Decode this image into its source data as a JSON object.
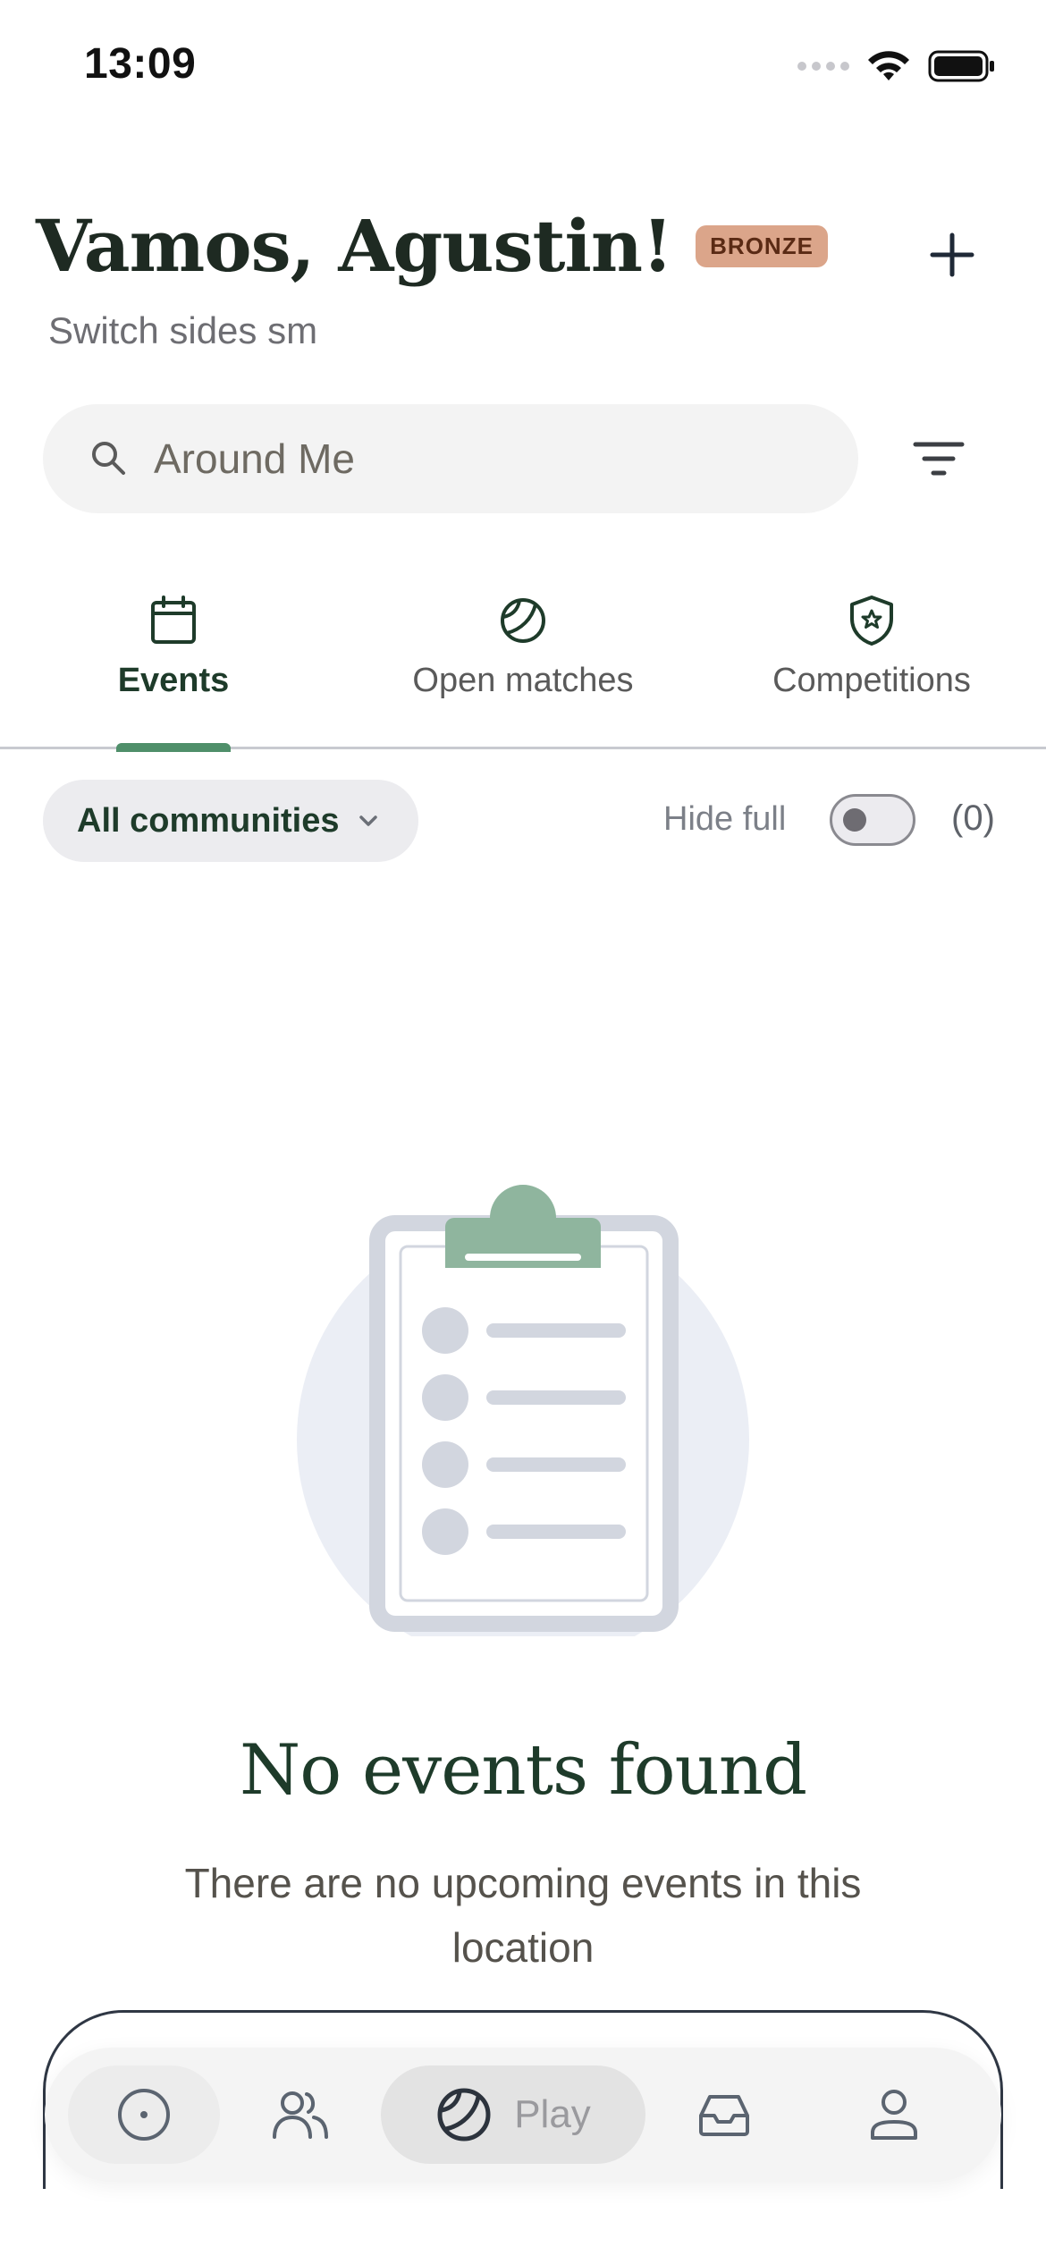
{
  "status_bar": {
    "time": "13:09"
  },
  "header": {
    "greeting": "Vamos, Agustin!",
    "rank_badge": "BRONZE",
    "subtitle": "Switch sides sm"
  },
  "search": {
    "placeholder": "Around Me"
  },
  "tabs": [
    {
      "label": "Events",
      "icon": "calendar-icon",
      "active": true
    },
    {
      "label": "Open matches",
      "icon": "tennis-ball-icon",
      "active": false
    },
    {
      "label": "Competitions",
      "icon": "shield-star-icon",
      "active": false
    }
  ],
  "filters": {
    "community_label": "All communities",
    "hide_full_label": "Hide full",
    "hide_full_on": false,
    "full_count": "(0)"
  },
  "empty_state": {
    "title": "No events found",
    "message": "There are no upcoming events in this location"
  },
  "bottom_nav": {
    "items": [
      {
        "icon": "home-circle-icon"
      },
      {
        "icon": "people-icon"
      },
      {
        "icon": "tennis-ball-icon",
        "label": "Play",
        "active": true
      },
      {
        "icon": "inbox-icon"
      },
      {
        "icon": "profile-icon"
      }
    ]
  },
  "colors": {
    "accent_green": "#4f8f6a",
    "dark_green": "#1e3b2a",
    "bronze": "#dba58a",
    "clipboard_green": "#8fb59e"
  }
}
